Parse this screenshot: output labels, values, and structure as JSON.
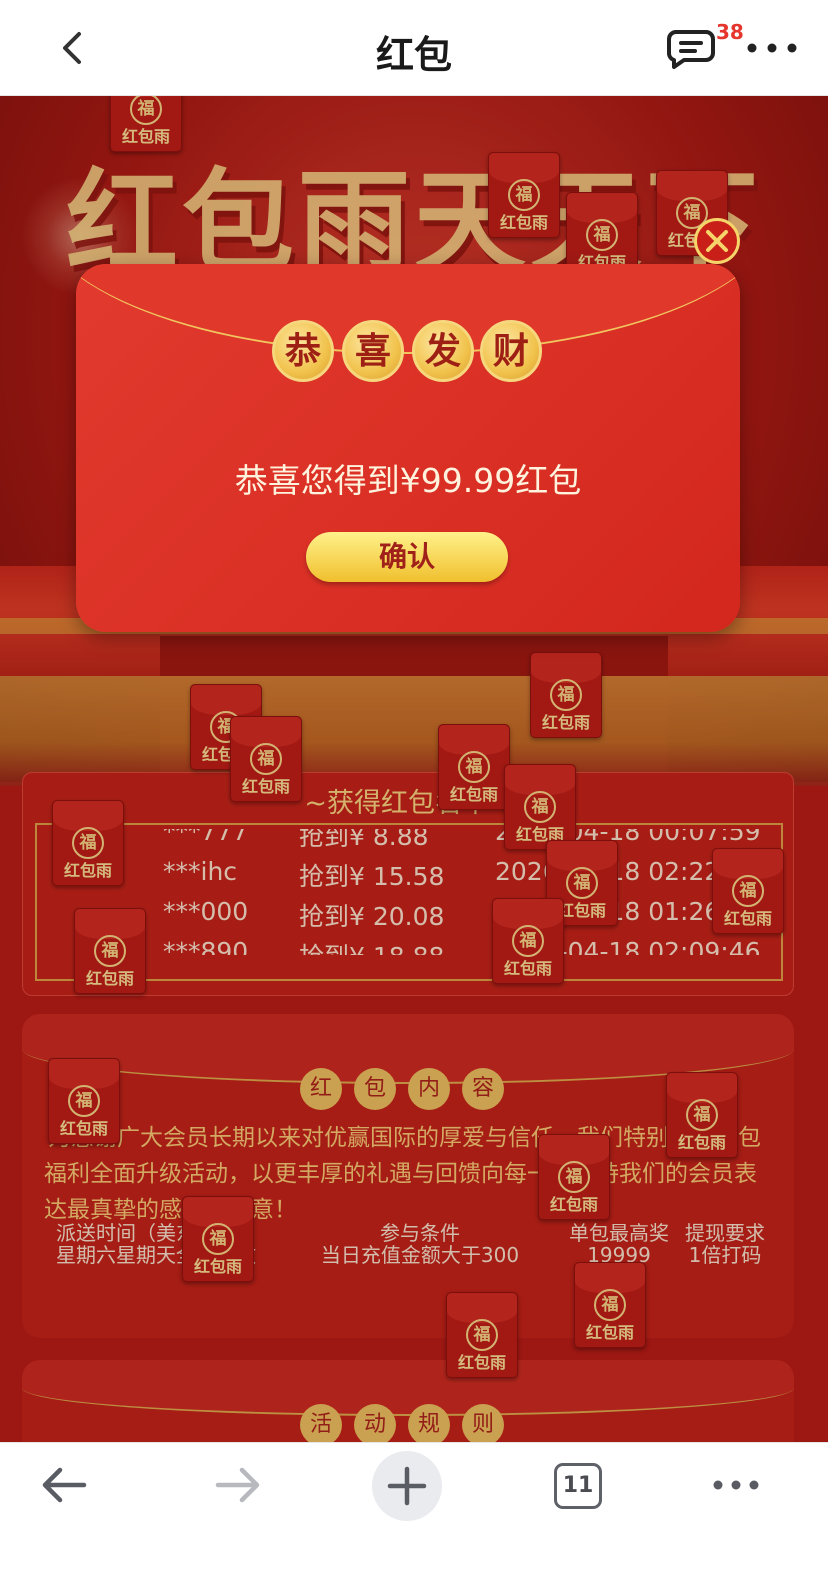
{
  "nav": {
    "title": "红包",
    "message_badge": "38"
  },
  "hero": {
    "title": "红包雨天天下"
  },
  "modal": {
    "coins": [
      "恭",
      "喜",
      "发",
      "财"
    ],
    "message": "恭喜您得到¥99.99红包",
    "confirm_label": "确认"
  },
  "winners": {
    "title": "~获得红包名单~",
    "rows": [
      {
        "name": "***777",
        "amount": "抢到¥ 8.88",
        "time": "2026-04-18 00:07:59"
      },
      {
        "name": "***ihc",
        "amount": "抢到¥ 15.58",
        "time": "2026-04-18 02:22:1"
      },
      {
        "name": "***000",
        "amount": "抢到¥ 20.08",
        "time": "2026-04-18 01:26:0"
      },
      {
        "name": "***890",
        "amount": "抢到¥ 18.88",
        "time": "2026-04-18 02:09:46"
      }
    ]
  },
  "content_panel": {
    "tags": [
      "红",
      "包",
      "内",
      "容"
    ],
    "paragraph": "为感谢广大会员长期以来对优赢国际的厚爱与信任，我们特别推出红包福利全面升级活动，以更丰厚的礼遇与回馈向每一位支持我们的会员表达最真挚的感谢与敬意！",
    "columns": [
      {
        "header": "派送时间（美东时间）",
        "value": "星期六星期天全天开放"
      },
      {
        "header": "参与条件",
        "value": "当日充值金额大于300"
      },
      {
        "header": "单包最高奖",
        "value": "19999"
      },
      {
        "header": "提现要求",
        "value": "1倍打码"
      }
    ]
  },
  "rules_panel": {
    "tags": [
      "活",
      "动",
      "规",
      "则"
    ]
  },
  "envelope": {
    "fu": "福",
    "label": "红包雨"
  },
  "toolbar": {
    "tab_count": "11"
  },
  "colors": {
    "page_red": "#b31b16",
    "modal_red": "#e23a2e",
    "gold": "#f1c34d",
    "badge_red": "#e5352d"
  }
}
